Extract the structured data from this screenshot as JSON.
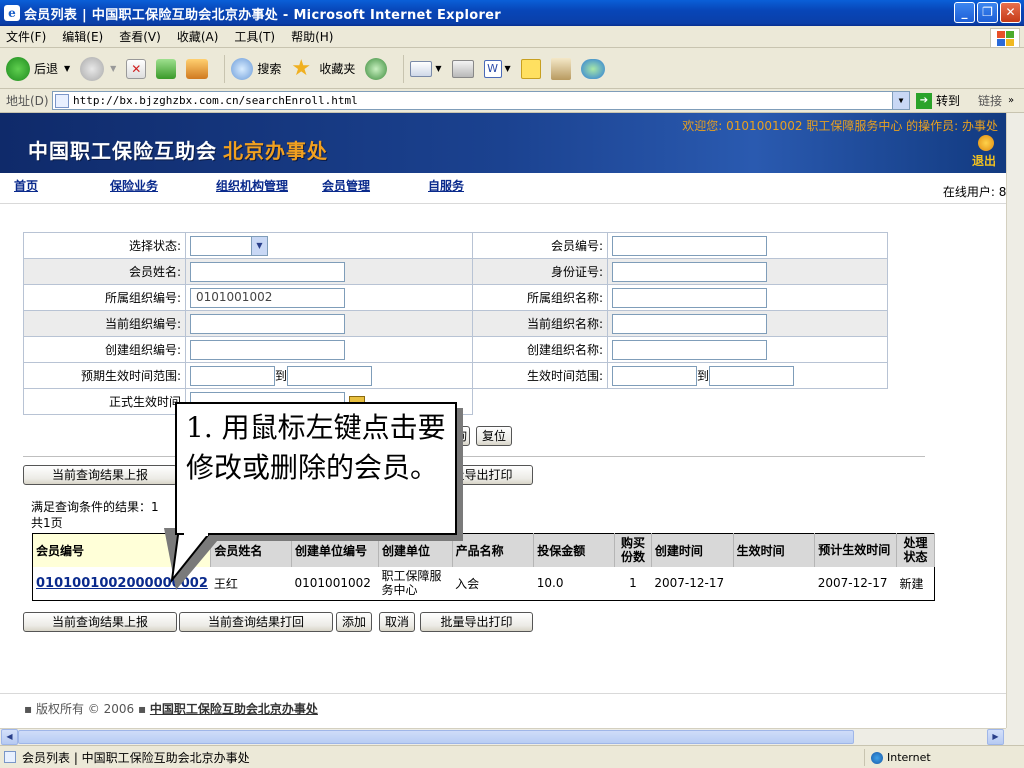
{
  "window": {
    "title": "会员列表 | 中国职工保险互助会北京办事处 - Microsoft Internet Explorer",
    "controls": [
      "_",
      "❐",
      "✕"
    ]
  },
  "menu": [
    "文件(F)",
    "编辑(E)",
    "查看(V)",
    "收藏(A)",
    "工具(T)",
    "帮助(H)"
  ],
  "toolbar": {
    "back": "后退",
    "search": "搜索",
    "favorites": "收藏夹"
  },
  "address": {
    "label": "地址(D)",
    "url": "http://bx.bjzghzbx.com.cn/searchEnroll.html",
    "go": "转到",
    "links": "链接"
  },
  "banner": {
    "logo_main": "中国职工保险互助会",
    "logo_sub": "北京办事处",
    "welcome": "欢迎您: 0101001002 职工保障服务中心 的操作员: 办事处",
    "logout": "退出"
  },
  "nav": [
    "首页",
    "保险业务",
    "组织机构管理",
    "会员管理",
    "自服务"
  ],
  "online_users": "在线用户: 87",
  "form": {
    "rows": [
      {
        "l1": "选择状态:",
        "l2": "会员编号:"
      },
      {
        "l1": "会员姓名:",
        "l2": "身份证号:"
      },
      {
        "l1": "所属组织编号:",
        "v1": "0101001002",
        "l2": "所属组织名称:"
      },
      {
        "l1": "当前组织编号:",
        "l2": "当前组织名称:"
      },
      {
        "l1": "创建组织编号:",
        "l2": "创建组织名称:"
      },
      {
        "l1": "预期生效时间范围:",
        "l2": "生效时间范围:"
      },
      {
        "l1": "正式生效时间"
      }
    ],
    "range_to": "到",
    "search_btn": "查询",
    "reset_btn": "复位"
  },
  "actions": {
    "report": "当前查询结果上报",
    "print_back": "当前查询结果打回",
    "add": "添加",
    "cancel": "取消",
    "batch_export": "批量导出打印"
  },
  "summary": {
    "line1": "满足查询条件的结果：1",
    "line2": "共1页"
  },
  "table": {
    "headers": [
      "会员编号",
      "会员姓名",
      "创建单位编号",
      "创建单位",
      "产品名称",
      "投保金额",
      "购买份数",
      "创建时间",
      "生效时间",
      "预计生效时间",
      "处理状态"
    ],
    "rows": [
      [
        "0101001002000000002",
        "王红",
        "0101001002",
        "职工保障服务中心",
        "入会",
        "10.0",
        "1",
        "2007-12-17",
        "",
        "2007-12-17",
        "新建"
      ]
    ]
  },
  "footer": {
    "copyright": "版权所有 © 2006",
    "org": "中国职工保险互助会北京办事处"
  },
  "status": {
    "text": "会员列表 | 中国职工保险互助会北京办事处",
    "zone": "Internet"
  },
  "callout": {
    "text": "1. 用鼠标左键点击要修改或删除的会员。"
  }
}
